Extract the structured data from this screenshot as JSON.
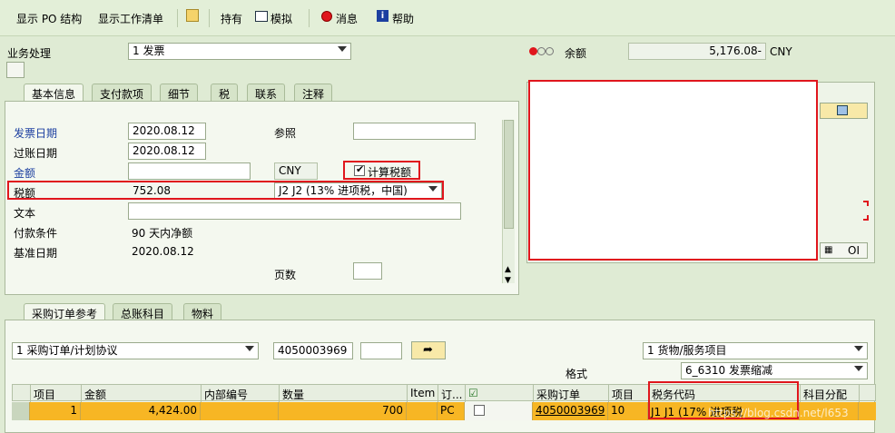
{
  "toolbar": {
    "show_po_structure": "显示 PO 结构",
    "show_worklist": "显示工作清单",
    "hold": "持有",
    "simulate": "模拟",
    "message": "消息",
    "help": "帮助"
  },
  "header": {
    "transaction_label": "业务处理",
    "transaction_value": "1 发票",
    "balance_label": "余额",
    "balance_value": "5,176.08-",
    "balance_currency": "CNY"
  },
  "basic_tabs": [
    "基本信息",
    "支付款项",
    "细节",
    "税",
    "联系",
    "注释"
  ],
  "basic": {
    "invoice_date_label": "发票日期",
    "invoice_date": "2020.08.12",
    "reference_label": "参照",
    "reference": "",
    "posting_date_label": "过账日期",
    "posting_date": "2020.08.12",
    "amount_label": "金额",
    "amount": "",
    "currency": "CNY",
    "calc_tax_label": "计算税额",
    "calc_tax_checked": true,
    "tax_amount_label": "税额",
    "tax_amount": "752.08",
    "tax_code": "J2 J2 (13% 进项税，中国)",
    "text_label": "文本",
    "text": "",
    "payment_terms_label": "付款条件",
    "payment_terms": "90 天内净额",
    "baseline_date_label": "基准日期",
    "baseline_date": "2020.08.12",
    "page_count_label": "页数",
    "page_count": ""
  },
  "right_panel": {
    "oi_button": "OI"
  },
  "ref_tabs": [
    "采购订单参考",
    "总账科目",
    "物料"
  ],
  "ref": {
    "doc_type": "1 采购订单/计划协议",
    "po_number": "4050003969",
    "po_item": "",
    "item_type": "1 货物/服务项目",
    "layout_label": "格式",
    "layout_value": "6_6310 发票缩减"
  },
  "grid": {
    "headers": [
      "项目",
      "金额",
      "内部编号",
      "数量",
      "Item",
      "订...",
      "",
      "采购订单",
      "项目",
      "税务代码",
      "科目分配"
    ],
    "rows": [
      {
        "item": "1",
        "amount": "4,424.00",
        "internal": "",
        "quantity": "700",
        "item_col": "",
        "unit": "PC",
        "po": "4050003969",
        "po_item": "10",
        "tax_code": "J1 J1 (17% 进项税",
        "acct": ""
      }
    ]
  },
  "watermark": "https://blog.csdn.net/l653",
  "colors": {
    "annotation_red": "#e0161d",
    "row_highlight": "#f7b624",
    "background": "#dfebd4"
  }
}
